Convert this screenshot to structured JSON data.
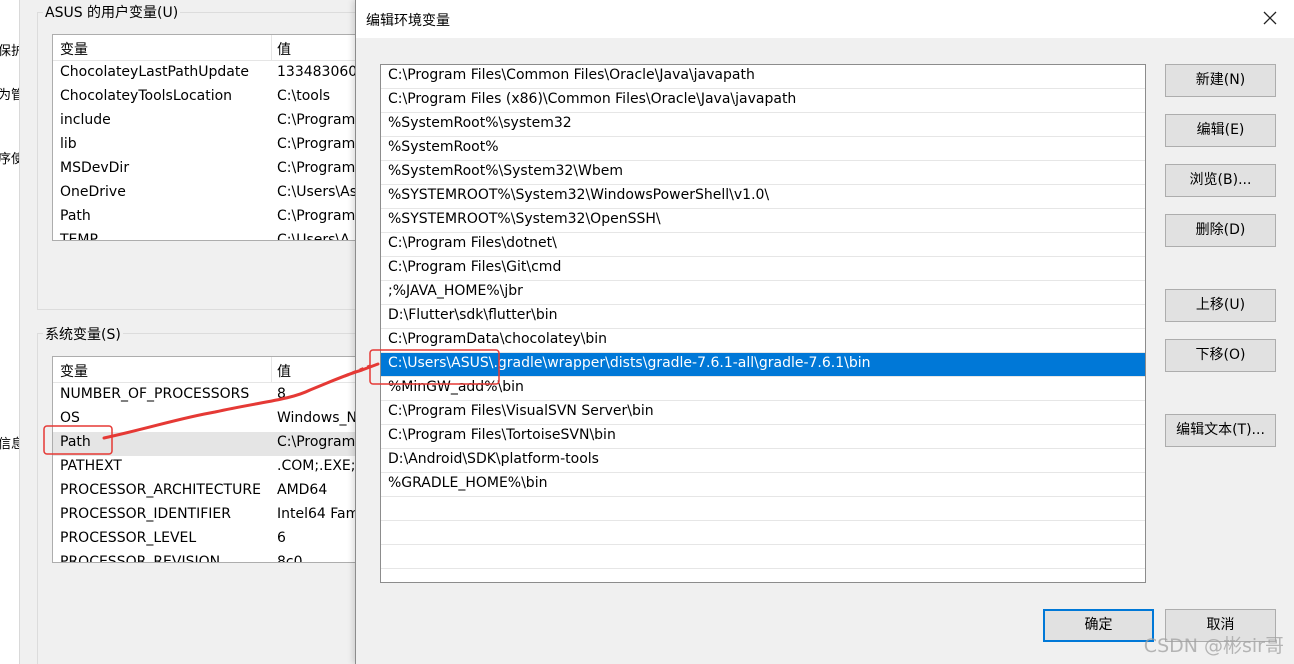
{
  "background_window": {
    "left_strip_fragments": [
      "保护",
      "为管",
      "序使",
      "信息"
    ],
    "user_vars": {
      "title": "ASUS 的用户变量(U)",
      "col_var": "变量",
      "col_val": "值",
      "rows": [
        {
          "name": "ChocolateyLastPathUpdate",
          "value": "133483060"
        },
        {
          "name": "ChocolateyToolsLocation",
          "value": "C:\\tools"
        },
        {
          "name": "include",
          "value": "C:\\Program"
        },
        {
          "name": "lib",
          "value": "C:\\Program"
        },
        {
          "name": "MSDevDir",
          "value": "C:\\Program"
        },
        {
          "name": "OneDrive",
          "value": "C:\\Users\\As"
        },
        {
          "name": "Path",
          "value": "C:\\Program"
        },
        {
          "name": "TEMP",
          "value": "C:\\Users\\A"
        }
      ]
    },
    "system_vars": {
      "title": "系统变量(S)",
      "col_var": "变量",
      "col_val": "值",
      "rows": [
        {
          "name": "NUMBER_OF_PROCESSORS",
          "value": "8"
        },
        {
          "name": "OS",
          "value": "Windows_N"
        },
        {
          "name": "Path",
          "value": "C:\\Program"
        },
        {
          "name": "PATHEXT",
          "value": ".COM;.EXE;"
        },
        {
          "name": "PROCESSOR_ARCHITECTURE",
          "value": "AMD64"
        },
        {
          "name": "PROCESSOR_IDENTIFIER",
          "value": "Intel64 Fam"
        },
        {
          "name": "PROCESSOR_LEVEL",
          "value": "6"
        },
        {
          "name": "PROCESSOR_REVISION",
          "value": "8c0"
        }
      ]
    }
  },
  "dialog": {
    "title": "编辑环境变量",
    "close_icon": "close-icon",
    "selected_index": 12,
    "paths": [
      "C:\\Program Files\\Common Files\\Oracle\\Java\\javapath",
      "C:\\Program Files (x86)\\Common Files\\Oracle\\Java\\javapath",
      "%SystemRoot%\\system32",
      "%SystemRoot%",
      "%SystemRoot%\\System32\\Wbem",
      "%SYSTEMROOT%\\System32\\WindowsPowerShell\\v1.0\\",
      "%SYSTEMROOT%\\System32\\OpenSSH\\",
      "C:\\Program Files\\dotnet\\",
      "C:\\Program Files\\Git\\cmd",
      ";%JAVA_HOME%\\jbr",
      "D:\\Flutter\\sdk\\flutter\\bin",
      "C:\\ProgramData\\chocolatey\\bin",
      "C:\\Users\\ASUS\\.gradle\\wrapper\\dists\\gradle-7.6.1-all\\gradle-7.6.1\\bin",
      "%MinGW_add%\\bin",
      "C:\\Program Files\\VisualSVN Server\\bin",
      "C:\\Program Files\\TortoiseSVN\\bin",
      "D:\\Android\\SDK\\platform-tools",
      "%GRADLE_HOME%\\bin"
    ],
    "buttons": {
      "new": "新建(N)",
      "edit": "编辑(E)",
      "browse": "浏览(B)...",
      "delete": "删除(D)",
      "move_up": "上移(U)",
      "move_down": "下移(O)",
      "edit_text": "编辑文本(T)...",
      "ok": "确定",
      "cancel": "取消"
    }
  },
  "watermark": "CSDN @彬sir哥",
  "colors": {
    "selection": "#0078d7",
    "annotation": "#e53935"
  }
}
